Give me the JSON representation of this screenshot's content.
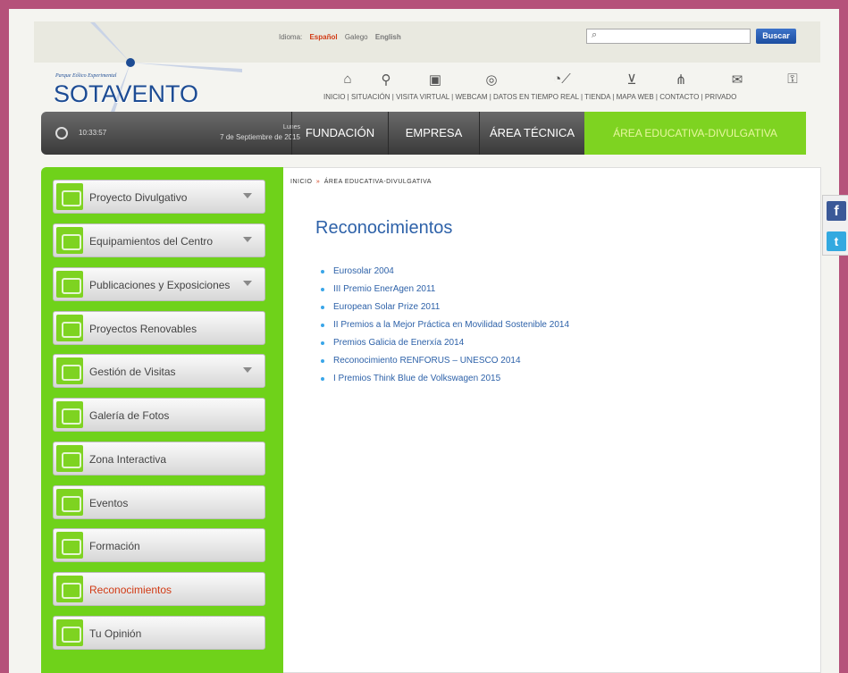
{
  "header": {
    "logo_top": "Parque Eólico Experimental",
    "logo_name": "SOTAVENTO",
    "language_label": "Idioma:",
    "languages": [
      "Español",
      "Galego",
      "English"
    ],
    "search_placeholder": "",
    "search_button": "Buscar"
  },
  "icon_nav": [
    {
      "label": "INICIO",
      "icon": "home-icon"
    },
    {
      "label": "SITUACIÓN",
      "icon": "location-pin-icon"
    },
    {
      "label": "VISITA VIRTUAL",
      "icon": "camera-icon"
    },
    {
      "label": "WEBCAM",
      "icon": "webcam-icon"
    },
    {
      "label": "DATOS EN TIEMPO REAL",
      "icon": "realtime-chart-icon"
    },
    {
      "label": "TIENDA",
      "icon": "cart-icon"
    },
    {
      "label": "MAPA WEB",
      "icon": "sitemap-icon"
    },
    {
      "label": "CONTACTO",
      "icon": "mail-icon"
    },
    {
      "label": "PRIVADO",
      "icon": "private-icon"
    }
  ],
  "mainnav": {
    "time": "10:33:57",
    "day": "Lunes",
    "date": "7 de Septiembre de 2015",
    "items": [
      "FUNDACIÓN",
      "EMPRESA",
      "ÁREA TÉCNICA",
      "ÁREA EDUCATIVA-DIVULGATIVA"
    ]
  },
  "sidebar": {
    "items": [
      {
        "label": "Proyecto Divulgativo",
        "has_dropdown": true
      },
      {
        "label": "Equipamientos del Centro",
        "has_dropdown": true
      },
      {
        "label": "Publicaciones y Exposiciones",
        "has_dropdown": true
      },
      {
        "label": "Proyectos Renovables",
        "has_dropdown": false
      },
      {
        "label": "Gestión de Visitas",
        "has_dropdown": true
      },
      {
        "label": "Galería de Fotos",
        "has_dropdown": false
      },
      {
        "label": "Zona Interactiva",
        "has_dropdown": false
      },
      {
        "label": "Eventos",
        "has_dropdown": false
      },
      {
        "label": "Formación",
        "has_dropdown": false
      },
      {
        "label": "Reconocimientos",
        "has_dropdown": false,
        "current": true
      },
      {
        "label": "Tu Opinión",
        "has_dropdown": false
      }
    ]
  },
  "breadcrumb": {
    "home": "INICIO",
    "separator": "»",
    "current": "ÁREA EDUCATIVA-DIVULGATIVA"
  },
  "page": {
    "title": "Reconocimientos",
    "awards": [
      "Eurosolar 2004",
      "III Premio EnerAgen 2011",
      "European Solar Prize 2011",
      "II Premios a la Mejor Práctica en Movilidad Sostenible 2014",
      "Premios Galicia de Enerxía 2014",
      "Reconocimiento RENFORUS – UNESCO 2014",
      "I Premios Think Blue de Volkswagen 2015"
    ]
  },
  "social": {
    "facebook": "f",
    "twitter": "t"
  },
  "colors": {
    "background": "#b5527a",
    "accent_green": "#7ed321",
    "link_blue": "#2e62a9",
    "active_red": "#d13a14"
  }
}
